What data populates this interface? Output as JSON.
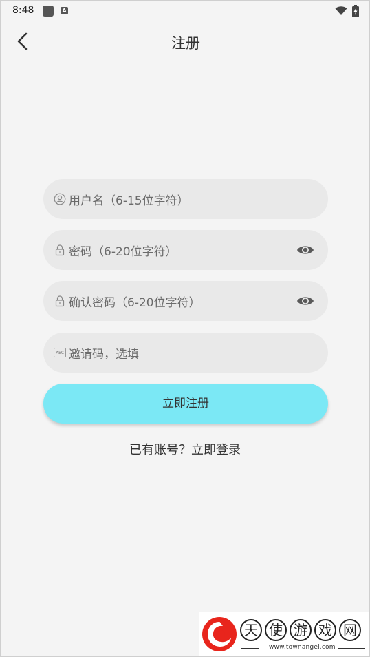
{
  "status_bar": {
    "time": "8:48",
    "icons": [
      "app-square-icon",
      "a-notification-icon",
      "wifi-icon",
      "battery-charging-icon"
    ],
    "a_letter": "A"
  },
  "header": {
    "title": "注册",
    "back_icon": "chevron-left-icon"
  },
  "form": {
    "username_placeholder": "用户名（6-15位字符）",
    "password_placeholder": "密码（6-20位字符）",
    "confirm_password_placeholder": "确认密码（6-20位字符）",
    "invite_placeholder": "邀请码，选填",
    "invite_icon_text": "ABC",
    "submit_label": "立即注册"
  },
  "footer": {
    "login_prompt": "已有账号？立即登录"
  },
  "watermark": {
    "chars": [
      "天",
      "使",
      "游",
      "戏",
      "网"
    ],
    "url": "www.townangel.com"
  },
  "colors": {
    "background": "#f4f4f4",
    "field_background": "#e9e9e9",
    "submit_background": "#7be8f5",
    "text": "#333333",
    "placeholder": "#6b6b6b",
    "logo_red": "#e8251c"
  }
}
